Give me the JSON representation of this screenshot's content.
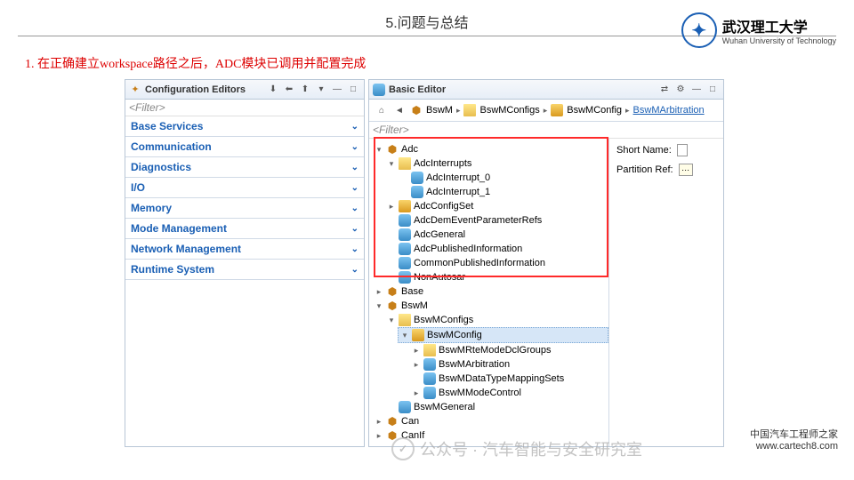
{
  "header": {
    "title": "5.问题与总结",
    "uni_cn": "武汉理工大学",
    "uni_en": "Wuhan University of Technology"
  },
  "note": "1. 在正确建立workspace路径之后，ADC模块已调用并配置完成",
  "cfg_panel": {
    "title": "Configuration Editors",
    "filter": "<Filter>",
    "categories": [
      "Base Services",
      "Communication",
      "Diagnostics",
      "I/O",
      "Memory",
      "Mode Management",
      "Network Management",
      "Runtime System"
    ]
  },
  "basic_panel": {
    "title": "Basic Editor",
    "filter": "<Filter>",
    "breadcrumb": [
      "BswM",
      "BswMConfigs",
      "BswMConfig",
      "BswMArbitration"
    ],
    "props": {
      "short_name": "Short Name:",
      "partition_ref": "Partition Ref:"
    },
    "tree": [
      {
        "l": "Adc",
        "i": "cubes",
        "o": true,
        "ch": [
          {
            "l": "AdcInterrupts",
            "i": "folder",
            "o": true,
            "ch": [
              {
                "l": "AdcInterrupt_0",
                "i": "db"
              },
              {
                "l": "AdcInterrupt_1",
                "i": "db"
              }
            ]
          },
          {
            "l": "AdcConfigSet",
            "i": "cube",
            "c": true
          },
          {
            "l": "AdcDemEventParameterRefs",
            "i": "db"
          },
          {
            "l": "AdcGeneral",
            "i": "db"
          },
          {
            "l": "AdcPublishedInformation",
            "i": "db"
          },
          {
            "l": "CommonPublishedInformation",
            "i": "db"
          },
          {
            "l": "NonAutosar",
            "i": "db"
          }
        ]
      },
      {
        "l": "Base",
        "i": "cubes",
        "c": true
      },
      {
        "l": "BswM",
        "i": "cubes",
        "o": true,
        "ch": [
          {
            "l": "BswMConfigs",
            "i": "folder",
            "o": true,
            "ch": [
              {
                "l": "BswMConfig",
                "i": "cube",
                "o": true,
                "sel": true,
                "ch": [
                  {
                    "l": "BswMRteModeDclGroups",
                    "i": "folder",
                    "c": true
                  },
                  {
                    "l": "BswMArbitration",
                    "i": "db",
                    "c": true
                  },
                  {
                    "l": "BswMDataTypeMappingSets",
                    "i": "db"
                  },
                  {
                    "l": "BswMModeControl",
                    "i": "db",
                    "c": true
                  }
                ]
              }
            ]
          },
          {
            "l": "BswMGeneral",
            "i": "db"
          }
        ]
      },
      {
        "l": "Can",
        "i": "cubes",
        "c": true
      },
      {
        "l": "CanIf",
        "i": "cubes",
        "c": true
      }
    ]
  },
  "wm": {
    "gzh": "公众号 · 汽车智能与安全研究室",
    "org": "中国汽车工程师之家",
    "url": "www.cartech8.com"
  }
}
